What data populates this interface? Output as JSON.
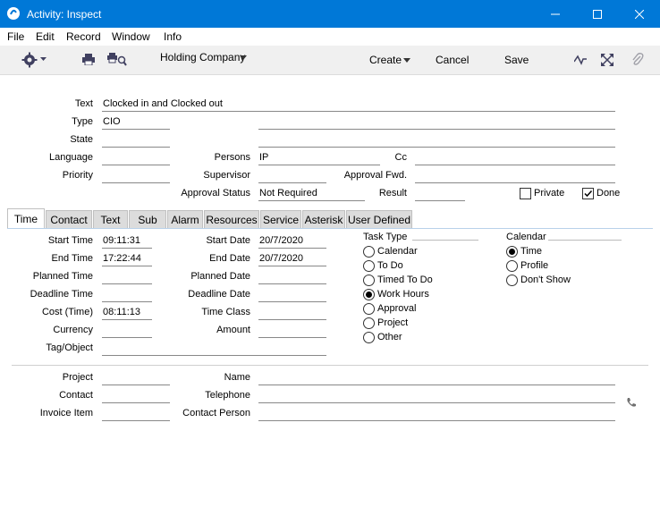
{
  "window": {
    "title": "Activity: Inspect"
  },
  "menu": [
    "File",
    "Edit",
    "Record",
    "Window",
    "Info"
  ],
  "toolbar": {
    "company": "Holding Company",
    "create": "Create",
    "cancel": "Cancel",
    "save": "Save"
  },
  "header_form": {
    "text_label": "Text",
    "text_value": "Clocked in and Clocked out",
    "type_label": "Type",
    "type_value": "CIO",
    "state_label": "State",
    "language_label": "Language",
    "persons_label": "Persons",
    "persons_value": "IP",
    "cc_label": "Cc",
    "priority_label": "Priority",
    "supervisor_label": "Supervisor",
    "approval_fwd_label": "Approval Fwd.",
    "approval_status_label": "Approval Status",
    "approval_status_value": "Not Required",
    "result_label": "Result",
    "private_label": "Private",
    "private_checked": false,
    "done_label": "Done",
    "done_checked": true
  },
  "tabs": [
    "Time",
    "Contact",
    "Text",
    "Sub",
    "Alarm",
    "Resources",
    "Service",
    "Asterisk",
    "User Defined"
  ],
  "active_tab": "Time",
  "time_tab": {
    "start_time_label": "Start Time",
    "start_time": "09:11:31",
    "end_time_label": "End Time",
    "end_time": "17:22:44",
    "planned_time_label": "Planned Time",
    "deadline_time_label": "Deadline Time",
    "cost_time_label": "Cost (Time)",
    "cost_time": "08:11:13",
    "currency_label": "Currency",
    "tag_object_label": "Tag/Object",
    "start_date_label": "Start Date",
    "start_date": "20/7/2020",
    "end_date_label": "End Date",
    "end_date": "20/7/2020",
    "planned_date_label": "Planned Date",
    "deadline_date_label": "Deadline Date",
    "time_class_label": "Time Class",
    "amount_label": "Amount",
    "task_type_label": "Task Type",
    "task_types": [
      "Calendar",
      "To Do",
      "Timed To Do",
      "Work Hours",
      "Approval",
      "Project",
      "Other"
    ],
    "task_type_selected": "Work Hours",
    "calendar_label": "Calendar",
    "calendar_options": [
      "Time",
      "Profile",
      "Don't Show"
    ],
    "calendar_selected": "Time"
  },
  "footer_form": {
    "project_label": "Project",
    "contact_label": "Contact",
    "invoice_item_label": "Invoice Item",
    "name_label": "Name",
    "telephone_label": "Telephone",
    "contact_person_label": "Contact Person"
  },
  "colors": {
    "titlebar": "#0078d7",
    "toolbar": "#f0f0f0",
    "tab_inactive": "#dcdcdc"
  },
  "icons": [
    "app-icon",
    "minimize-icon",
    "maximize-icon",
    "close-icon",
    "gear-icon",
    "print-icon",
    "search-print-icon",
    "activity-icon",
    "expand-icon",
    "paperclip-icon",
    "phone-icon"
  ]
}
